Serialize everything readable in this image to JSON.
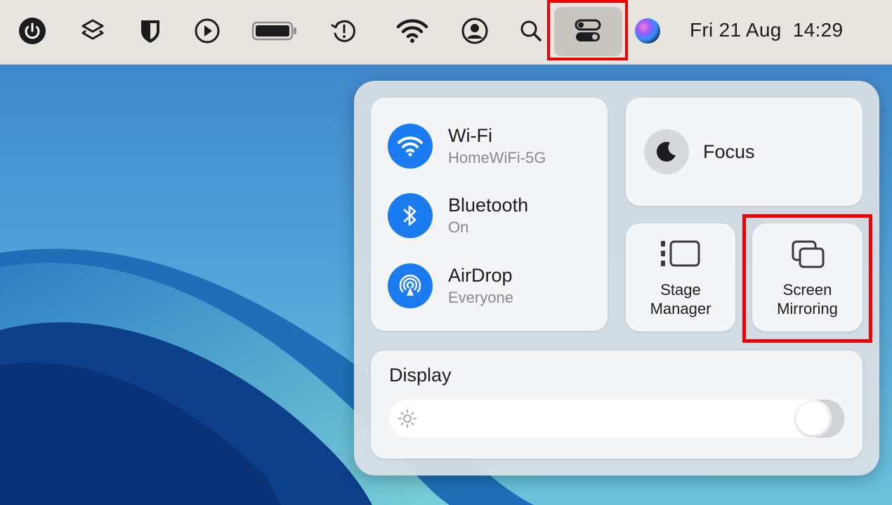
{
  "menubar": {
    "icons": [
      "power-icon",
      "shortcuts-icon",
      "bitwarden-shield-icon",
      "play-icon",
      "battery-icon",
      "time-machine-icon",
      "wifi-icon",
      "user-icon",
      "search-icon",
      "control-center-icon",
      "siri-icon"
    ],
    "datetime": "Fri 21 Aug  14:29"
  },
  "control_center": {
    "network": [
      {
        "title": "Wi-Fi",
        "subtitle": "HomeWiFi-5G",
        "icon": "wifi-icon"
      },
      {
        "title": "Bluetooth",
        "subtitle": "On",
        "icon": "bluetooth-icon"
      },
      {
        "title": "AirDrop",
        "subtitle": "Everyone",
        "icon": "airdrop-icon"
      }
    ],
    "focus": {
      "label": "Focus",
      "icon": "moon-icon"
    },
    "stage_manager": {
      "line1": "Stage",
      "line2": "Manager",
      "icon": "stage-manager-icon"
    },
    "screen_mirroring": {
      "line1": "Screen",
      "line2": "Mirroring",
      "icon": "screen-mirroring-icon"
    },
    "display": {
      "title": "Display",
      "brightness": 0.97
    }
  },
  "colors": {
    "accent_blue": "#1b7cf2",
    "highlight_red": "#f00000",
    "menubar_bg": "#e8e5e1"
  }
}
